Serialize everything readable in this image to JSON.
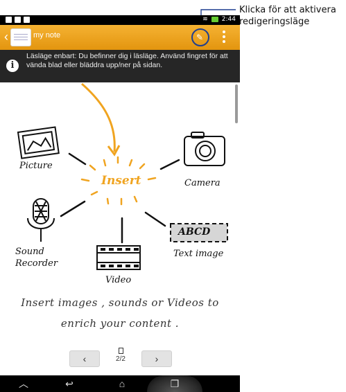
{
  "callout": {
    "lines": [
      "Klicka för att aktivera",
      "redigeringsläge"
    ]
  },
  "statusbar": {
    "time": "2:44"
  },
  "actionbar": {
    "title": "my note",
    "edit_icon": "pencil-icon",
    "menu_icon": "overflow-menu-icon"
  },
  "info": {
    "text": "Läsläge enbart: Du befinner dig i läsläge. Använd fingret för att vända blad eller bläddra upp/ner på sidan."
  },
  "illustration": {
    "center": "Insert",
    "picture": "Picture",
    "camera": "Camera",
    "sound_1": "Sound",
    "sound_2": "Recorder",
    "abcd": "ABCD",
    "text_image": "Text image",
    "video": "Video"
  },
  "tagline": {
    "line1": "Insert images , sounds or Videos to",
    "line2": "enrich your content ."
  },
  "pager": {
    "prev": "‹",
    "next": "›",
    "page": "2/2"
  },
  "colors": {
    "accent": "#f0a420",
    "callout_circle": "#1f3f8f"
  }
}
